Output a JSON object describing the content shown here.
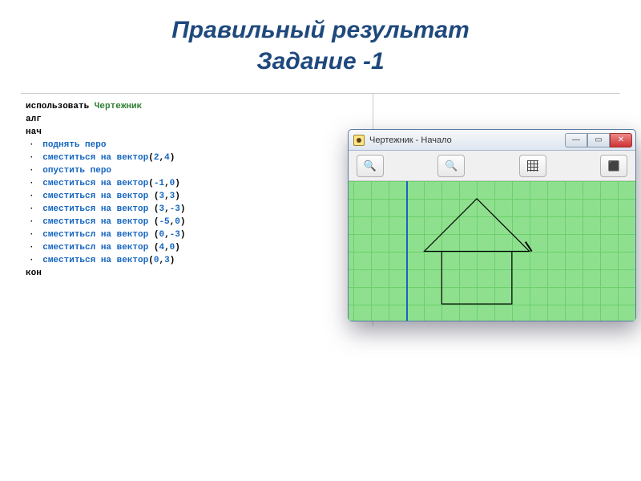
{
  "title_line1": "Правильный результат",
  "title_line2": "Задание -1",
  "code": {
    "use_kw": "использовать",
    "module": "Чертежник",
    "alg": "алг",
    "begin": "нач",
    "end": "кон",
    "pen_up": "поднять перо",
    "pen_down": "опустить перо",
    "cmds": [
      {
        "text": "сместиться на вектор",
        "args": "(2,4)"
      },
      {
        "text": "сместиться на вектор",
        "args": "(-1,0)"
      },
      {
        "text": "сместиться на вектор ",
        "args": "(3,3)"
      },
      {
        "text": "сместиться на вектор ",
        "args": "(3,-3)"
      },
      {
        "text": "сместиться на вектор ",
        "args": "(-5,0)"
      },
      {
        "text": "сместитьсл на вектор ",
        "args": "(0,-3)"
      },
      {
        "text": "сместитьсл на вектор ",
        "args": "(4,0)"
      },
      {
        "text": "сместиться на вектор",
        "args": "(0,3)"
      }
    ]
  },
  "drawer_window": {
    "title": "Чертежник - Начало"
  }
}
